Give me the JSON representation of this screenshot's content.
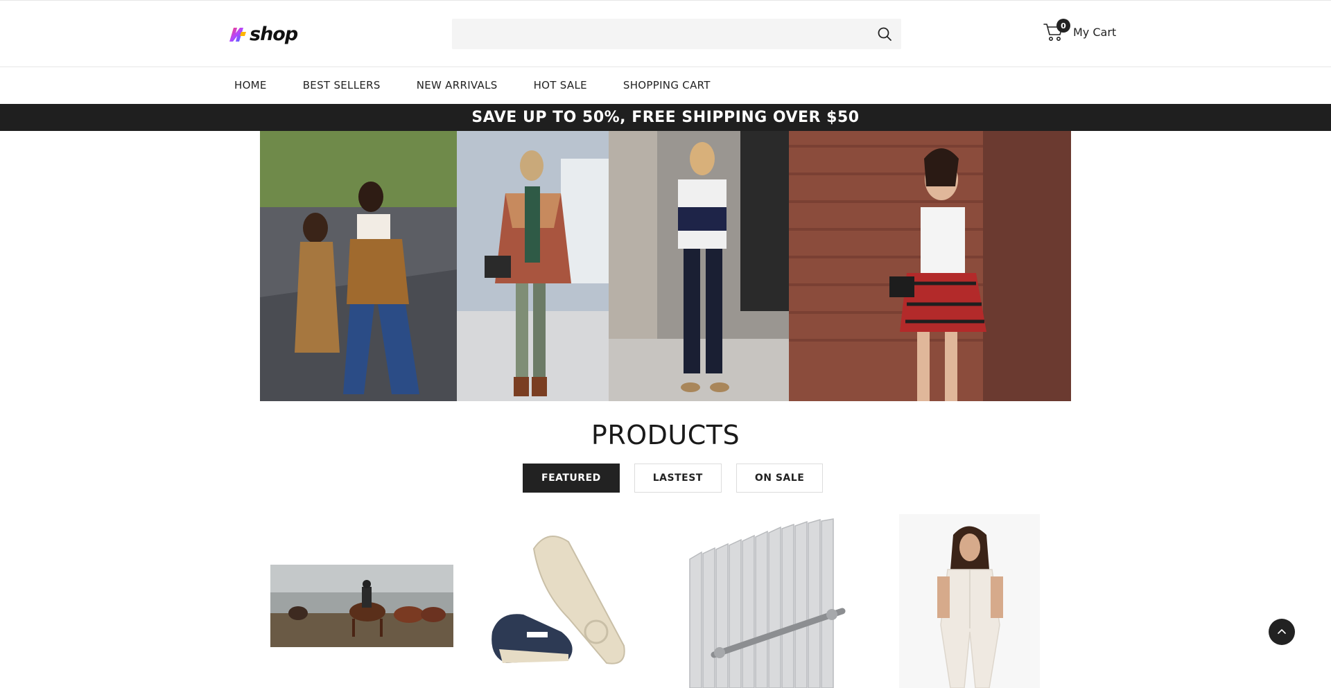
{
  "header": {
    "logo_text": "shop",
    "search": {
      "placeholder": "",
      "value": ""
    },
    "cart": {
      "count": "0",
      "label": "My Cart"
    }
  },
  "nav": {
    "items": [
      {
        "label": "HOME"
      },
      {
        "label": "BEST SELLERS"
      },
      {
        "label": "NEW ARRIVALS"
      },
      {
        "label": "HOT SALE"
      },
      {
        "label": "SHOPPING CART"
      }
    ]
  },
  "promo": {
    "text": "SAVE UP TO 50%, FREE SHIPPING OVER $50"
  },
  "products": {
    "title": "PRODUCTS",
    "tabs": [
      {
        "label": "FEATURED",
        "active": true
      },
      {
        "label": "LASTEST",
        "active": false
      },
      {
        "label": "ON SALE",
        "active": false
      }
    ]
  },
  "icons": {
    "search": "search-icon",
    "cart": "cart-icon",
    "back_to_top": "chevron-up-icon"
  },
  "colors": {
    "promo_bar": "#1f1f1f",
    "active_tab": "#222222",
    "search_bg": "#f4f4f4"
  }
}
